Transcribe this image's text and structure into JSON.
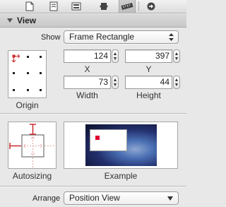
{
  "toolbar": {
    "icons": [
      "file-icon",
      "quick-help-icon",
      "identity-icon",
      "attributes-icon",
      "size-ruler-icon",
      "connections-icon"
    ],
    "selected": "size-ruler-icon"
  },
  "section": {
    "title": "View"
  },
  "show": {
    "label": "Show",
    "value": "Frame Rectangle"
  },
  "frame": {
    "x": {
      "value": "124",
      "label": "X"
    },
    "y": {
      "value": "397",
      "label": "Y"
    },
    "width": {
      "value": "73",
      "label": "Width"
    },
    "height": {
      "value": "44",
      "label": "Height"
    }
  },
  "origin": {
    "label": "Origin",
    "selected_anchor": "top-left"
  },
  "autosizing": {
    "label": "Autosizing"
  },
  "example": {
    "label": "Example"
  },
  "arrange": {
    "label": "Arrange",
    "value": "Position View"
  },
  "colors": {
    "accent_red": "#cc2b2b",
    "example_red": "#e0002a"
  }
}
